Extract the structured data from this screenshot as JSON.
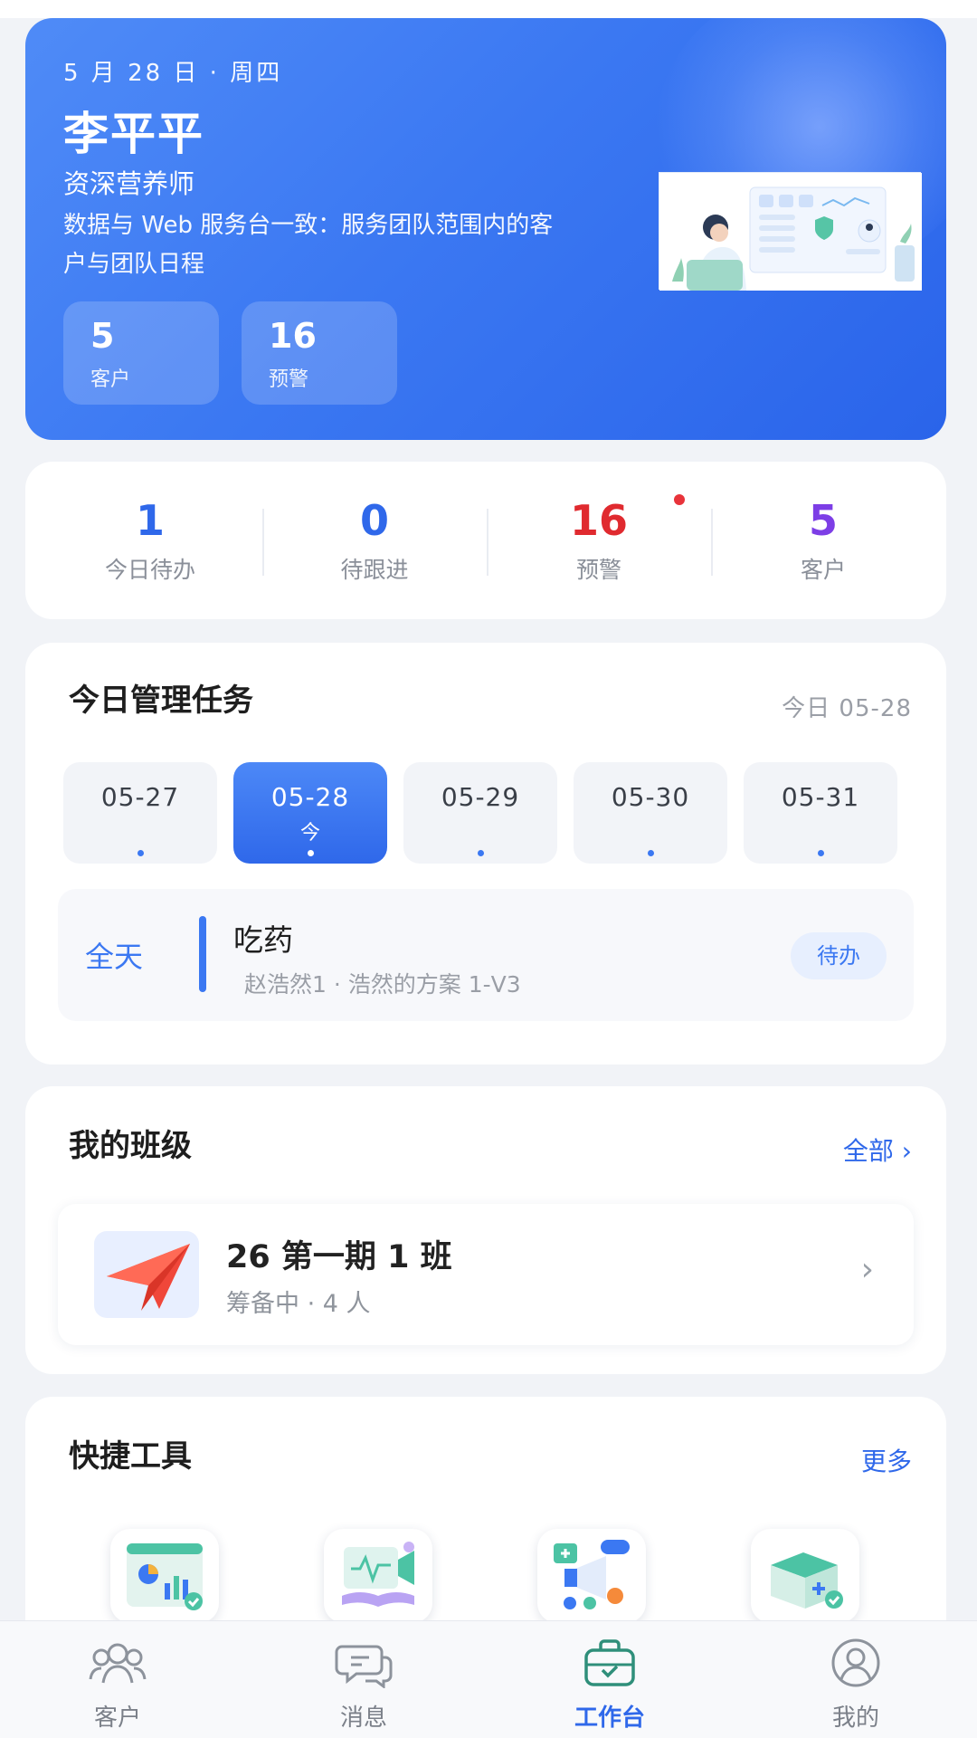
{
  "header": {
    "date": "5 月 28 日 · 周四",
    "name": "李平平",
    "role": "资深营养师",
    "description": "数据与 Web 服务台一致：服务团队范围内的客户与团队日程",
    "stats": [
      {
        "value": "5",
        "label": "客户"
      },
      {
        "value": "16",
        "label": "预警"
      }
    ]
  },
  "summary": {
    "items": [
      {
        "value": "1",
        "label": "今日待办",
        "color": "#2f68ea"
      },
      {
        "value": "0",
        "label": "待跟进",
        "color": "#2f68ea"
      },
      {
        "value": "16",
        "label": "预警",
        "color": "#e02a2f"
      },
      {
        "value": "5",
        "label": "客户",
        "color": "#7d3ee6"
      }
    ]
  },
  "tasks": {
    "title": "今日管理任务",
    "today_label": "今日 05-28",
    "days": [
      {
        "date": "05-27"
      },
      {
        "date": "05-28",
        "today": "今"
      },
      {
        "date": "05-29"
      },
      {
        "date": "05-30"
      },
      {
        "date": "05-31"
      }
    ],
    "selected_day": 1,
    "items": [
      {
        "time": "全天",
        "title": "吃药",
        "subtitle": "赵浩然1 · 浩然的方案 1-V3",
        "status": "待办"
      }
    ]
  },
  "classes": {
    "title": "我的班级",
    "more_label": "全部 ›",
    "items": [
      {
        "name": "26 第一期 1 班",
        "subtitle": "筹备中 · 4 人",
        "icon": "paper-plane-icon"
      }
    ]
  },
  "tools": {
    "title": "快捷工具",
    "more_label": "更多",
    "items": [
      {
        "icon": "report-chart-icon"
      },
      {
        "icon": "video-lesson-icon"
      },
      {
        "icon": "announcement-icon"
      },
      {
        "icon": "medical-box-icon"
      }
    ]
  },
  "tabbar": {
    "items": [
      {
        "label": "客户",
        "icon": "users-icon"
      },
      {
        "label": "消息",
        "icon": "chat-icon"
      },
      {
        "label": "工作台",
        "icon": "briefcase-icon"
      },
      {
        "label": "我的",
        "icon": "profile-icon"
      }
    ],
    "active": 2
  },
  "colors": {
    "primary": "#2f68ea",
    "alert": "#e02a2f",
    "customer": "#7d3ee6"
  }
}
